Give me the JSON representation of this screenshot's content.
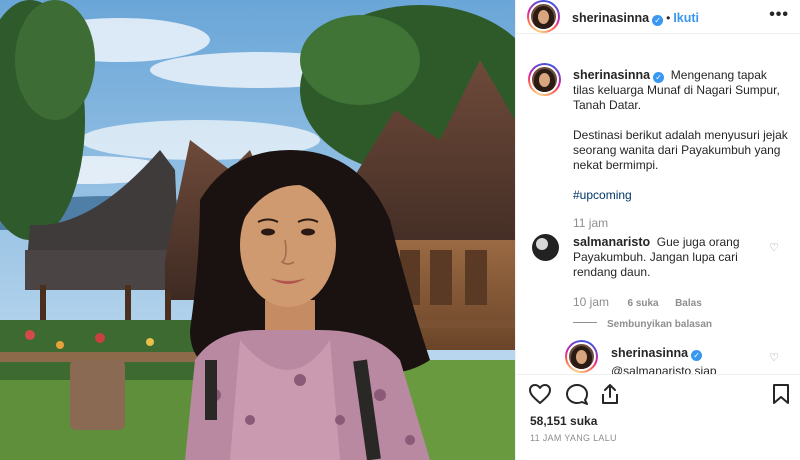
{
  "post": {
    "username": "sherinasinna",
    "follow_label": "Ikuti",
    "more_icon": "•••",
    "verified_icon": "✓"
  },
  "caption": {
    "username": "sherinasinna",
    "text_part1": "Mengenang tapak tilas keluarga Munaf di Nagari Sumpur, Tanah Datar.",
    "text_part2": "Destinasi berikut adalah menyusuri jejak seorang wanita dari Payakumbuh yang nekat bermimpi.",
    "hashtag": "#upcoming",
    "time": "11 jam"
  },
  "comment": {
    "username": "salmanaristo",
    "text": "Gue juga orang Payakumbuh. Jangan lupa cari rendang daun.",
    "time": "10 jam",
    "likes": "6 suka",
    "reply_label": "Balas",
    "hide_replies": "Sembunyikan balasan"
  },
  "reply": {
    "username": "sherinasinna",
    "text": "@salmanaristo siap"
  },
  "stats": {
    "likes": "58,151 suka",
    "time_ago": "11 JAM YANG LALU"
  },
  "colors": {
    "link": "#3897f0",
    "hashtag": "#003569",
    "muted": "#8e8e8e",
    "text": "#262626",
    "divider": "#efefef"
  }
}
